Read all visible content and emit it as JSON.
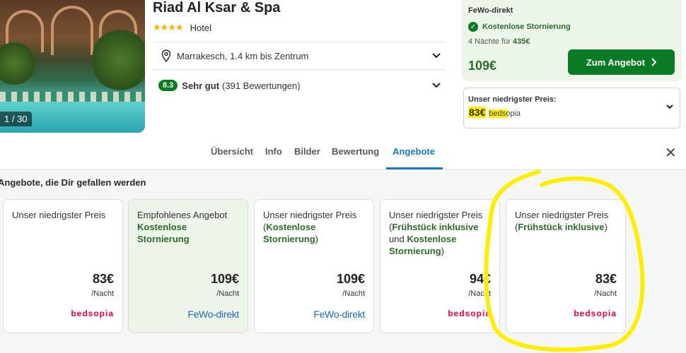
{
  "hotel": {
    "name": "Riad Al Ksar & Spa",
    "stars": "★★★★",
    "type": "Hotel",
    "location": "Marrakesch, 1.4 km bis Zentrum",
    "score": "8.3",
    "score_label": "Sehr gut",
    "reviews": "(391 Bewertungen)",
    "photo_counter": "1 / 30"
  },
  "deal": {
    "provider": "FeWo-direkt",
    "cancellation": "Kostenlose Stornierung",
    "nights_text": "4 Nächte für",
    "nights_total": "435€",
    "price": "109€",
    "button": "Zum Angebot"
  },
  "lowest": {
    "title": "Unser niedrigster Preis:",
    "price": "83€",
    "provider": "bedsopia"
  },
  "tabs": [
    {
      "label": "Übersicht"
    },
    {
      "label": "Info"
    },
    {
      "label": "Bilder"
    },
    {
      "label": "Bewertung"
    },
    {
      "label": "Angebote"
    }
  ],
  "offers_title": "Angebote, die Dir gefallen werden",
  "offers": [
    {
      "line1": "Unser niedrigster Preis",
      "line2": "",
      "line3": "",
      "price": "83€",
      "per": "/Nacht",
      "provider": "bedsopia"
    },
    {
      "line1": "Empfohlenes Angebot",
      "line2": "Kostenlose Stornierung",
      "line3": "",
      "price": "109€",
      "per": "/Nacht",
      "provider": "FeWo-direkt"
    },
    {
      "line1": "Unser niedrigster Preis",
      "line2": "Kostenlose Stornierung",
      "line3": "",
      "price": "109€",
      "per": "/Nacht",
      "provider": "FeWo-direkt"
    },
    {
      "line1": "Unser niedrigster Preis",
      "line2": "Frühstück inklusive",
      "line3": "Kostenlose Stornierung",
      "price": "94€",
      "per": "/Nacht",
      "provider": "bedsopia"
    },
    {
      "line1": "Unser niedrigster Preis",
      "line2": "Frühstück inklusive",
      "line3": "",
      "price": "83€",
      "per": "/Nacht",
      "provider": "bedsopia"
    }
  ],
  "colors": {
    "brand_green": "#0b7a24",
    "link_blue": "#1a7ac7",
    "bedsopia_red": "#e4003a",
    "highlight_yellow": "#ffee00"
  }
}
